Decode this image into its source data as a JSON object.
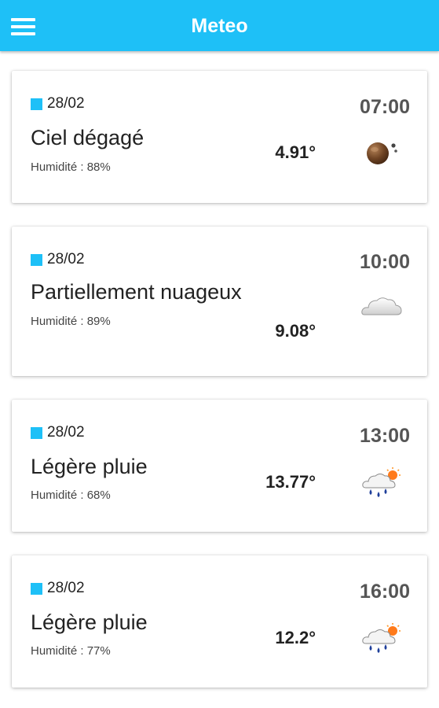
{
  "app": {
    "title": "Meteo",
    "menu_icon": "hamburger-menu-icon",
    "accent_color": "#1ec0f7"
  },
  "forecasts": [
    {
      "date": "28/02",
      "time": "07:00",
      "description": "Ciel dégagé",
      "humidity": "Humidité : 88%",
      "temperature": "4.91°",
      "icon": "moon-icon"
    },
    {
      "date": "28/02",
      "time": "10:00",
      "description": "Partiellement nuageux",
      "humidity": "Humidité : 89%",
      "temperature": "9.08°",
      "icon": "cloud-icon"
    },
    {
      "date": "28/02",
      "time": "13:00",
      "description": "Légère pluie",
      "humidity": "Humidité : 68%",
      "temperature": "13.77°",
      "icon": "light-rain-icon"
    },
    {
      "date": "28/02",
      "time": "16:00",
      "description": "Légère pluie",
      "humidity": "Humidité : 77%",
      "temperature": "12.2°",
      "icon": "light-rain-icon"
    }
  ]
}
